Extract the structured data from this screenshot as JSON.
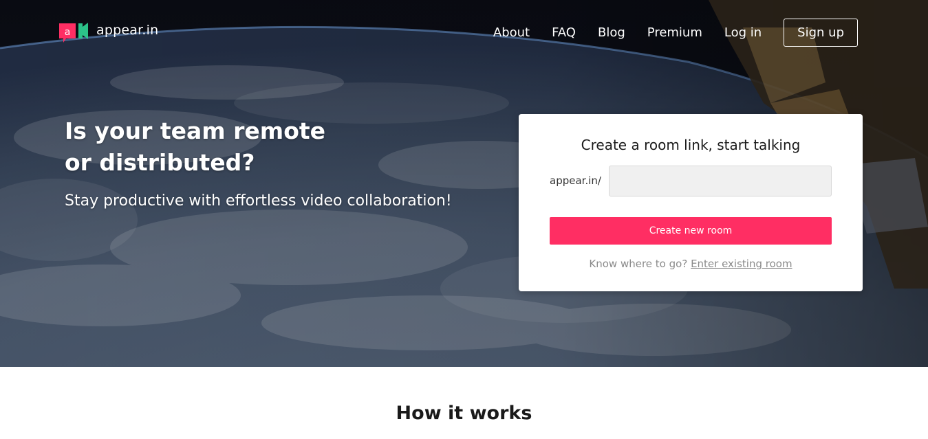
{
  "brand": {
    "name": "appear.in",
    "mark_letter": "a",
    "colors": {
      "pink": "#ff2e63",
      "green": "#2ecc8f",
      "white": "#ffffff"
    }
  },
  "nav": {
    "items": [
      {
        "label": "About"
      },
      {
        "label": "FAQ"
      },
      {
        "label": "Blog"
      },
      {
        "label": "Premium"
      },
      {
        "label": "Log in"
      }
    ],
    "signup_label": "Sign up"
  },
  "hero": {
    "headline_line1": "Is your team remote",
    "headline_line2": "or distributed?",
    "subline": "Stay productive with effortless video collaboration!"
  },
  "room_card": {
    "title": "Create a room link, start talking",
    "url_prefix": "appear.in/",
    "room_name_value": "",
    "create_button_label": "Create new room",
    "existing_prompt": "Know where to go?",
    "existing_link_label": "Enter existing room",
    "accent_color": "#ff2e63"
  },
  "how_it_works": {
    "title": "How it works"
  }
}
